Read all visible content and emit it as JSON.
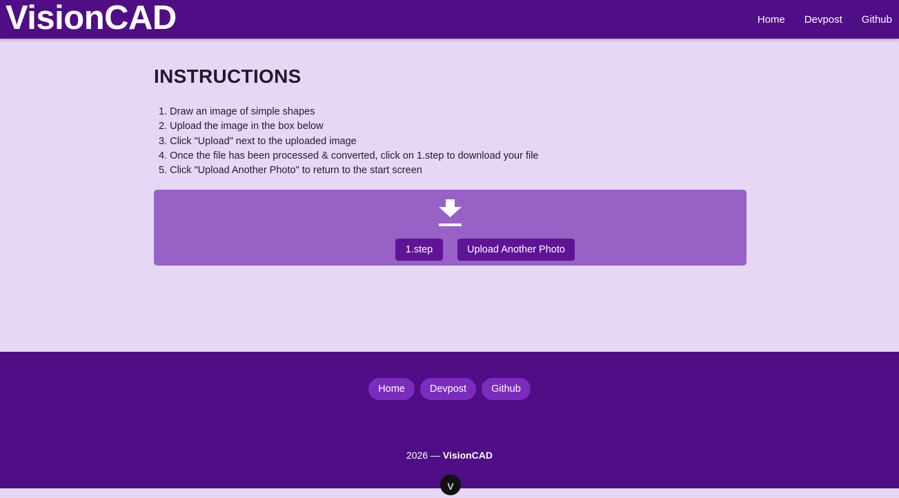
{
  "header": {
    "brand": "VisionCAD",
    "nav": [
      {
        "label": "Home"
      },
      {
        "label": "Devpost"
      },
      {
        "label": "Github"
      }
    ]
  },
  "main": {
    "title": "INSTRUCTIONS",
    "steps": [
      {
        "num": "1.",
        "text": "Draw an image of simple shapes"
      },
      {
        "num": "2.",
        "text": "Upload the image in the box below"
      },
      {
        "num": "3.",
        "text": "Click \"Upload\" next to the uploaded image"
      },
      {
        "num": "4.",
        "text": "Once the file has been processed & converted, click on 1.step to download your file"
      },
      {
        "num": "5.",
        "text": "Click \"Upload Another Photo\" to return to the start screen"
      }
    ],
    "upload_box": {
      "icon": "download-icon",
      "file_button": "1.step",
      "another_button": "Upload Another Photo"
    }
  },
  "footer": {
    "links": [
      {
        "label": "Home"
      },
      {
        "label": "Devpost"
      },
      {
        "label": "Github"
      }
    ],
    "copyright_year": "2026 —",
    "copyright_brand": "VisionCAD",
    "badge": "V"
  },
  "colors": {
    "header_bg": "#4f0d86",
    "page_bg": "#e6d8f5",
    "box_bg": "#9761c6",
    "button_bg": "#5f1496",
    "pill_bg": "#7b2cbf"
  }
}
